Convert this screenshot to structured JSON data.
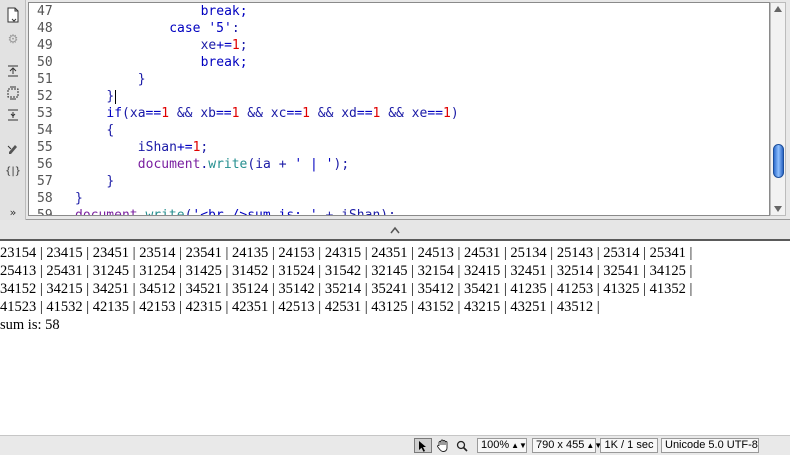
{
  "editor": {
    "lines": [
      {
        "num": "47",
        "indent": 4,
        "tokens": [
          {
            "t": "break;",
            "c": "kw"
          }
        ]
      },
      {
        "num": "48",
        "indent": 3,
        "tokens": [
          {
            "t": "case '5'",
            "c": "kw"
          },
          {
            "t": ":",
            "c": "txt"
          }
        ]
      },
      {
        "num": "49",
        "indent": 4,
        "tokens": [
          {
            "t": "xe",
            "c": "txt"
          },
          {
            "t": "+=",
            "c": "kw"
          },
          {
            "t": "1",
            "c": "num"
          },
          {
            "t": ";",
            "c": "txt"
          }
        ]
      },
      {
        "num": "50",
        "indent": 4,
        "tokens": [
          {
            "t": "break;",
            "c": "kw"
          }
        ]
      },
      {
        "num": "51",
        "indent": 2,
        "tokens": [
          {
            "t": "}",
            "c": "txt"
          }
        ]
      },
      {
        "num": "52",
        "indent": 1,
        "tokens": [
          {
            "t": "}",
            "c": "txt"
          }
        ],
        "caret": true
      },
      {
        "num": "53",
        "indent": 1,
        "tokens": [
          {
            "t": "if",
            "c": "kw"
          },
          {
            "t": "(xa",
            "c": "txt"
          },
          {
            "t": "==",
            "c": "kw"
          },
          {
            "t": "1",
            "c": "num"
          },
          {
            "t": " && xb",
            "c": "txt"
          },
          {
            "t": "==",
            "c": "kw"
          },
          {
            "t": "1",
            "c": "num"
          },
          {
            "t": " && xc",
            "c": "txt"
          },
          {
            "t": "==",
            "c": "kw"
          },
          {
            "t": "1",
            "c": "num"
          },
          {
            "t": " && xd",
            "c": "txt"
          },
          {
            "t": "==",
            "c": "kw"
          },
          {
            "t": "1",
            "c": "num"
          },
          {
            "t": " && xe",
            "c": "txt"
          },
          {
            "t": "==",
            "c": "kw"
          },
          {
            "t": "1",
            "c": "num"
          },
          {
            "t": ")",
            "c": "txt"
          }
        ]
      },
      {
        "num": "54",
        "indent": 1,
        "tokens": [
          {
            "t": "{",
            "c": "txt"
          }
        ]
      },
      {
        "num": "55",
        "indent": 2,
        "tokens": [
          {
            "t": "iShan",
            "c": "txt"
          },
          {
            "t": "+=",
            "c": "kw"
          },
          {
            "t": "1",
            "c": "num"
          },
          {
            "t": ";",
            "c": "txt"
          }
        ]
      },
      {
        "num": "56",
        "indent": 2,
        "tokens": [
          {
            "t": "document",
            "c": "obj"
          },
          {
            "t": ".",
            "c": "txt"
          },
          {
            "t": "write",
            "c": "fn"
          },
          {
            "t": "(ia + ",
            "c": "txt"
          },
          {
            "t": "' | '",
            "c": "str"
          },
          {
            "t": ");",
            "c": "txt"
          }
        ]
      },
      {
        "num": "57",
        "indent": 1,
        "tokens": [
          {
            "t": "}",
            "c": "txt"
          }
        ]
      },
      {
        "num": "58",
        "indent": 0,
        "tokens": [
          {
            "t": "}",
            "c": "txt"
          }
        ]
      },
      {
        "num": "59",
        "indent": 0,
        "tokens": [
          {
            "t": "document",
            "c": "obj"
          },
          {
            "t": ".",
            "c": "txt"
          },
          {
            "t": "write",
            "c": "fn"
          },
          {
            "t": "(",
            "c": "txt"
          },
          {
            "t": "'<br />sum is: '",
            "c": "str"
          },
          {
            "t": " + iShan);",
            "c": "txt"
          }
        ]
      }
    ]
  },
  "toolbar": {
    "icons": [
      {
        "name": "file-options-icon",
        "glyph": "📄"
      },
      {
        "name": "gear-icon",
        "glyph": "⚙"
      },
      {
        "name": "expand-selection-icon",
        "glyph": "⇱"
      },
      {
        "name": "collapse-selection-icon",
        "glyph": "⬚"
      },
      {
        "name": "expand-all-icon",
        "glyph": "✱"
      },
      {
        "name": "apply-comment-icon",
        "glyph": "✎"
      },
      {
        "name": "wrap-tag-icon",
        "glyph": "{|}"
      },
      {
        "name": "more-tools-icon",
        "glyph": "»"
      }
    ]
  },
  "output": {
    "lines": [
      "23154 | 23415 | 23451 | 23514 | 23541 | 24135 | 24153 | 24315 | 24351 | 24513 | 24531 | 25134 | 25143 | 25314 | 25341 |",
      "25413 | 25431 | 31245 | 31254 | 31425 | 31452 | 31524 | 31542 | 32145 | 32154 | 32415 | 32451 | 32514 | 32541 | 34125 |",
      "34152 | 34215 | 34251 | 34512 | 34521 | 35124 | 35142 | 35214 | 35241 | 35412 | 35421 | 41235 | 41253 | 41325 | 41352 |",
      "41523 | 41532 | 42135 | 42153 | 42315 | 42351 | 42513 | 42531 | 43125 | 43152 | 43215 | 43251 | 43512 |",
      "sum is: 58"
    ]
  },
  "status": {
    "zoom": "100%",
    "window_size": "790 x 455",
    "download": "1K / 1 sec",
    "encoding": "Unicode 5.0 UTF-8"
  }
}
